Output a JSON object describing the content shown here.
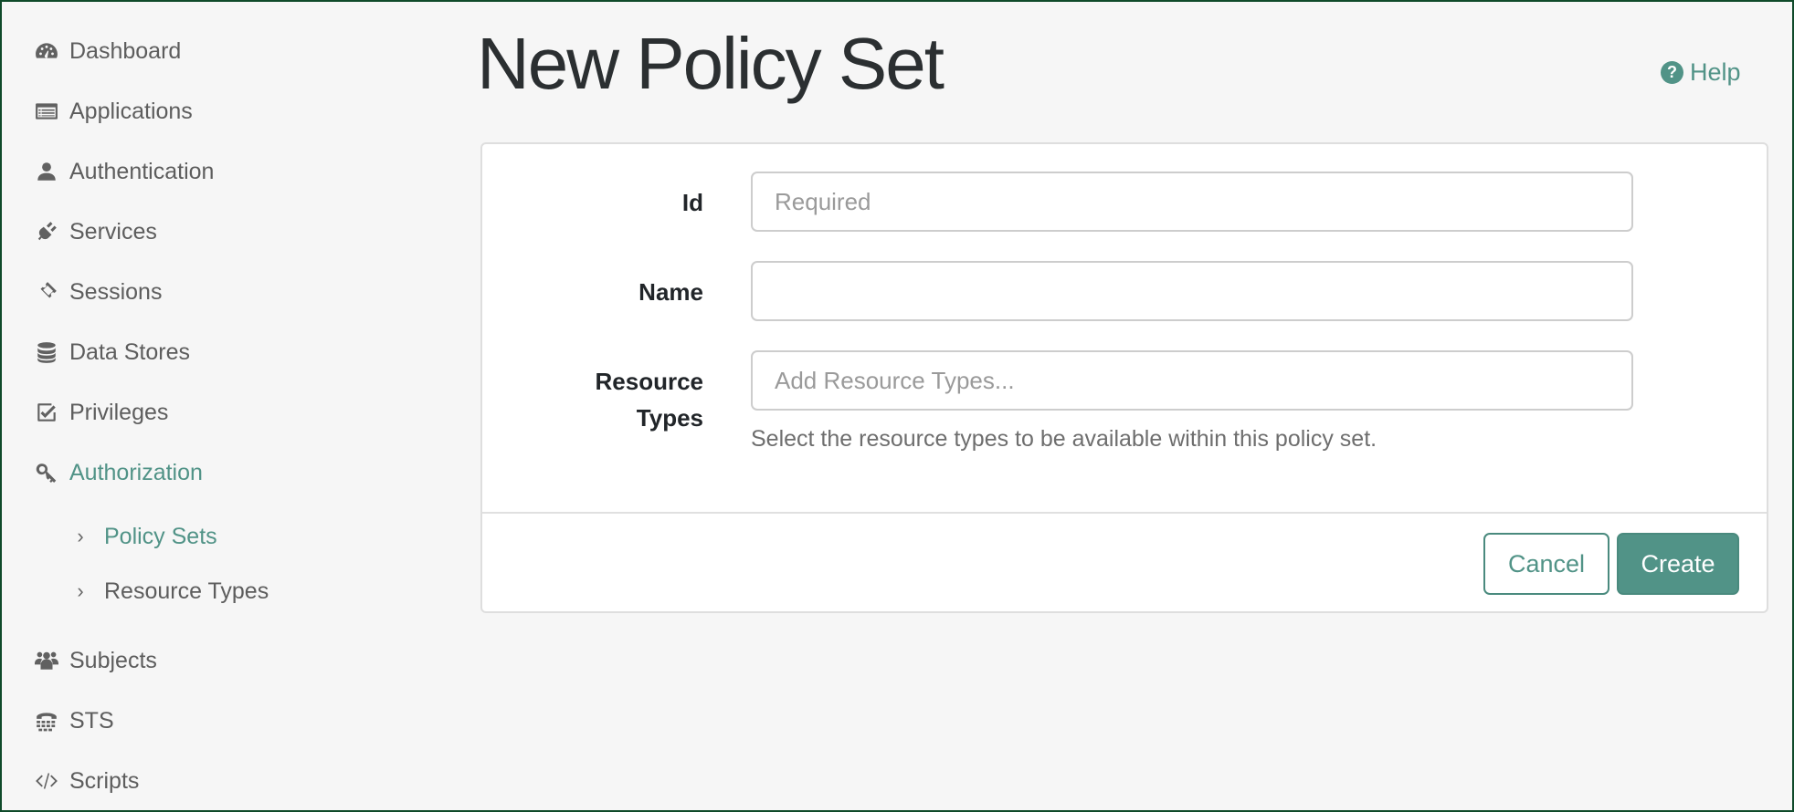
{
  "sidebar": {
    "items": [
      {
        "label": "Dashboard",
        "icon": "dashboard-icon"
      },
      {
        "label": "Applications",
        "icon": "applications-icon"
      },
      {
        "label": "Authentication",
        "icon": "user-icon"
      },
      {
        "label": "Services",
        "icon": "plug-icon"
      },
      {
        "label": "Sessions",
        "icon": "ticket-icon"
      },
      {
        "label": "Data Stores",
        "icon": "database-icon"
      },
      {
        "label": "Privileges",
        "icon": "checkbox-icon"
      },
      {
        "label": "Authorization",
        "icon": "key-icon",
        "active": true
      },
      {
        "label": "Subjects",
        "icon": "users-icon"
      },
      {
        "label": "STS",
        "icon": "phone-icon"
      },
      {
        "label": "Scripts",
        "icon": "code-icon"
      }
    ],
    "sub_items": [
      {
        "label": "Policy Sets",
        "active": true
      },
      {
        "label": "Resource Types"
      }
    ]
  },
  "header": {
    "title": "New Policy Set",
    "help_label": "Help"
  },
  "form": {
    "id": {
      "label": "Id",
      "value": "",
      "placeholder": "Required"
    },
    "name": {
      "label": "Name",
      "value": "",
      "placeholder": ""
    },
    "resource_types": {
      "label_line1": "Resource",
      "label_line2": "Types",
      "value": "",
      "placeholder": "Add Resource Types...",
      "help": "Select the resource types to be available within this policy set."
    }
  },
  "actions": {
    "cancel_label": "Cancel",
    "create_label": "Create"
  },
  "colors": {
    "accent": "#519387",
    "background": "#f6f6f6",
    "text": "#5d5d5d"
  }
}
